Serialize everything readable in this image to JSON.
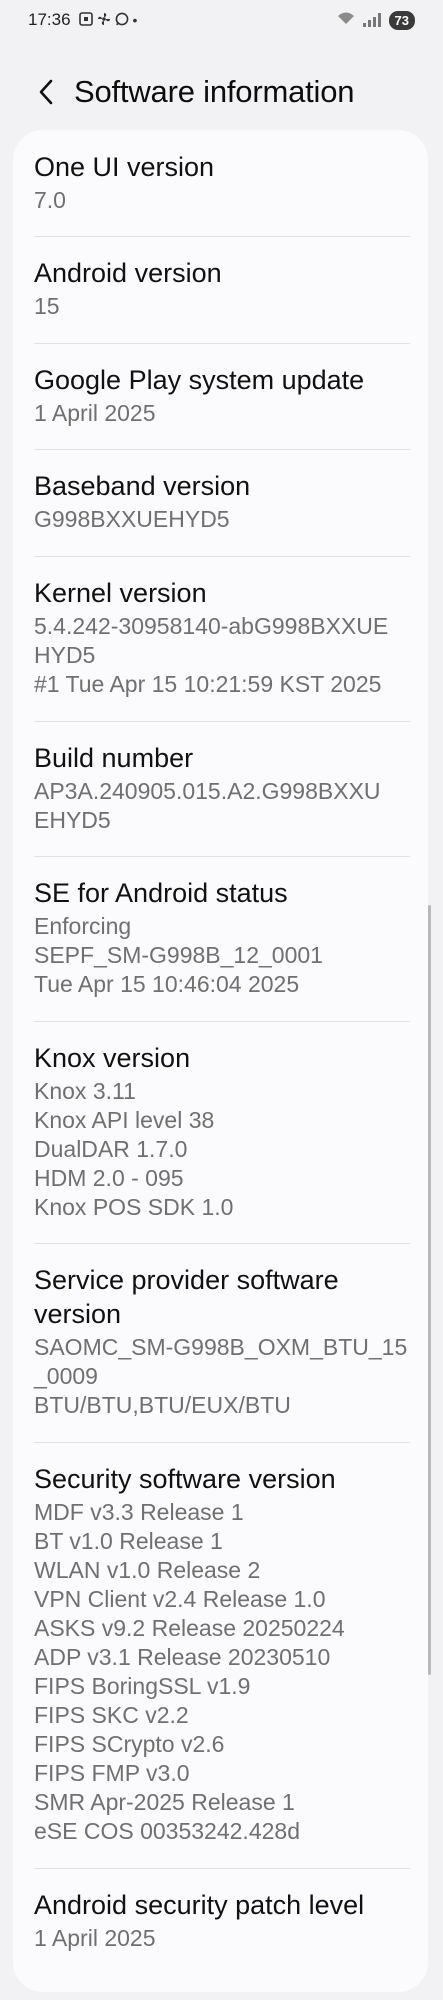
{
  "status_bar": {
    "time": "17:36",
    "notification_icons": [
      "screenshot-icon",
      "fan-icon",
      "whatsapp-icon",
      "dot-icon"
    ],
    "battery": "73"
  },
  "header": {
    "back_icon": "chevron-left-icon",
    "title": "Software information"
  },
  "items": [
    {
      "title": "One UI version",
      "value": "7.0"
    },
    {
      "title": "Android version",
      "value": "15"
    },
    {
      "title": "Google Play system update",
      "value": "1 April 2025"
    },
    {
      "title": "Baseband version",
      "value": "G998BXXUEHYD5"
    },
    {
      "title": "Kernel version",
      "value": "5.4.242-30958140-abG998BXXUE\nHYD5\n#1 Tue Apr 15 10:21:59 KST 2025"
    },
    {
      "title": "Build number",
      "value": "AP3A.240905.015.A2.G998BXXU\nEHYD5"
    },
    {
      "title": "SE for Android status",
      "value": "Enforcing\nSEPF_SM-G998B_12_0001\nTue Apr 15 10:46:04 2025"
    },
    {
      "title": "Knox version",
      "value": "Knox 3.11\nKnox API level 38\nDualDAR 1.7.0\nHDM 2.0 - 095\nKnox POS SDK 1.0"
    },
    {
      "title": "Service provider software\nversion",
      "value": "SAOMC_SM-G998B_OXM_BTU_15\n_0009\nBTU/BTU,BTU/EUX/BTU"
    },
    {
      "title": "Security software version",
      "value": "MDF v3.3 Release 1\nBT v1.0 Release 1\nWLAN v1.0 Release 2\nVPN Client v2.4 Release 1.0\nASKS v9.2  Release 20250224\nADP v3.1 Release 20230510\nFIPS BoringSSL v1.9\nFIPS SKC v2.2\nFIPS SCrypto v2.6\nFIPS FMP v3.0\nSMR Apr-2025 Release 1\neSE COS 00353242.428d"
    },
    {
      "title": "Android security patch level",
      "value": "1 April 2025"
    }
  ]
}
